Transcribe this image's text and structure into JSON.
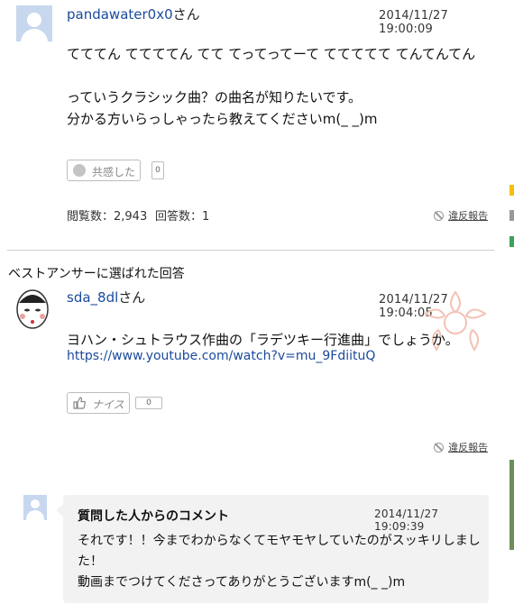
{
  "question": {
    "username": "pandawater0x0",
    "honorific": "さん",
    "timestamp": "2014/11/27　19:00:09",
    "lines": [
      "てててん ててててん てて てってってーて ててててて てんてんてん",
      "",
      "っていうクラシック曲？の曲名が知りたいです。",
      "分かる方いらっしゃったら教えてくださいm(_ _)m"
    ],
    "empathy_label": "共感した",
    "empathy_count": "0",
    "views_label": "閲覧数：2,943",
    "answers_label": "回答数：1",
    "report_label": "違反報告"
  },
  "best_answer": {
    "heading": "ベストアンサーに選ばれた回答",
    "username": "sda_8dl",
    "honorific": "さん",
    "timestamp": "2014/11/27　19:04:05",
    "text": "ヨハン・シュトラウス作曲の「ラデツキー行進曲」でしょうか。",
    "link": "https://www.youtube.com/watch?v=mu_9FdiituQ",
    "nice_label": "ナイス",
    "nice_count": "0",
    "report_label": "違反報告"
  },
  "comment": {
    "title": "質問した人からのコメント",
    "timestamp": "2014/11/27 19:09:39",
    "lines": [
      "それです！！今までわからなくてモヤモヤしていたのがスッキリしまし",
      "た！",
      "動画までつけてくださってありがとうございますm(_ _)m"
    ]
  },
  "colors": {
    "link": "#1a4a9c",
    "comment_bg": "#f2f2f2",
    "avatar_default": "#c7d7ee"
  }
}
